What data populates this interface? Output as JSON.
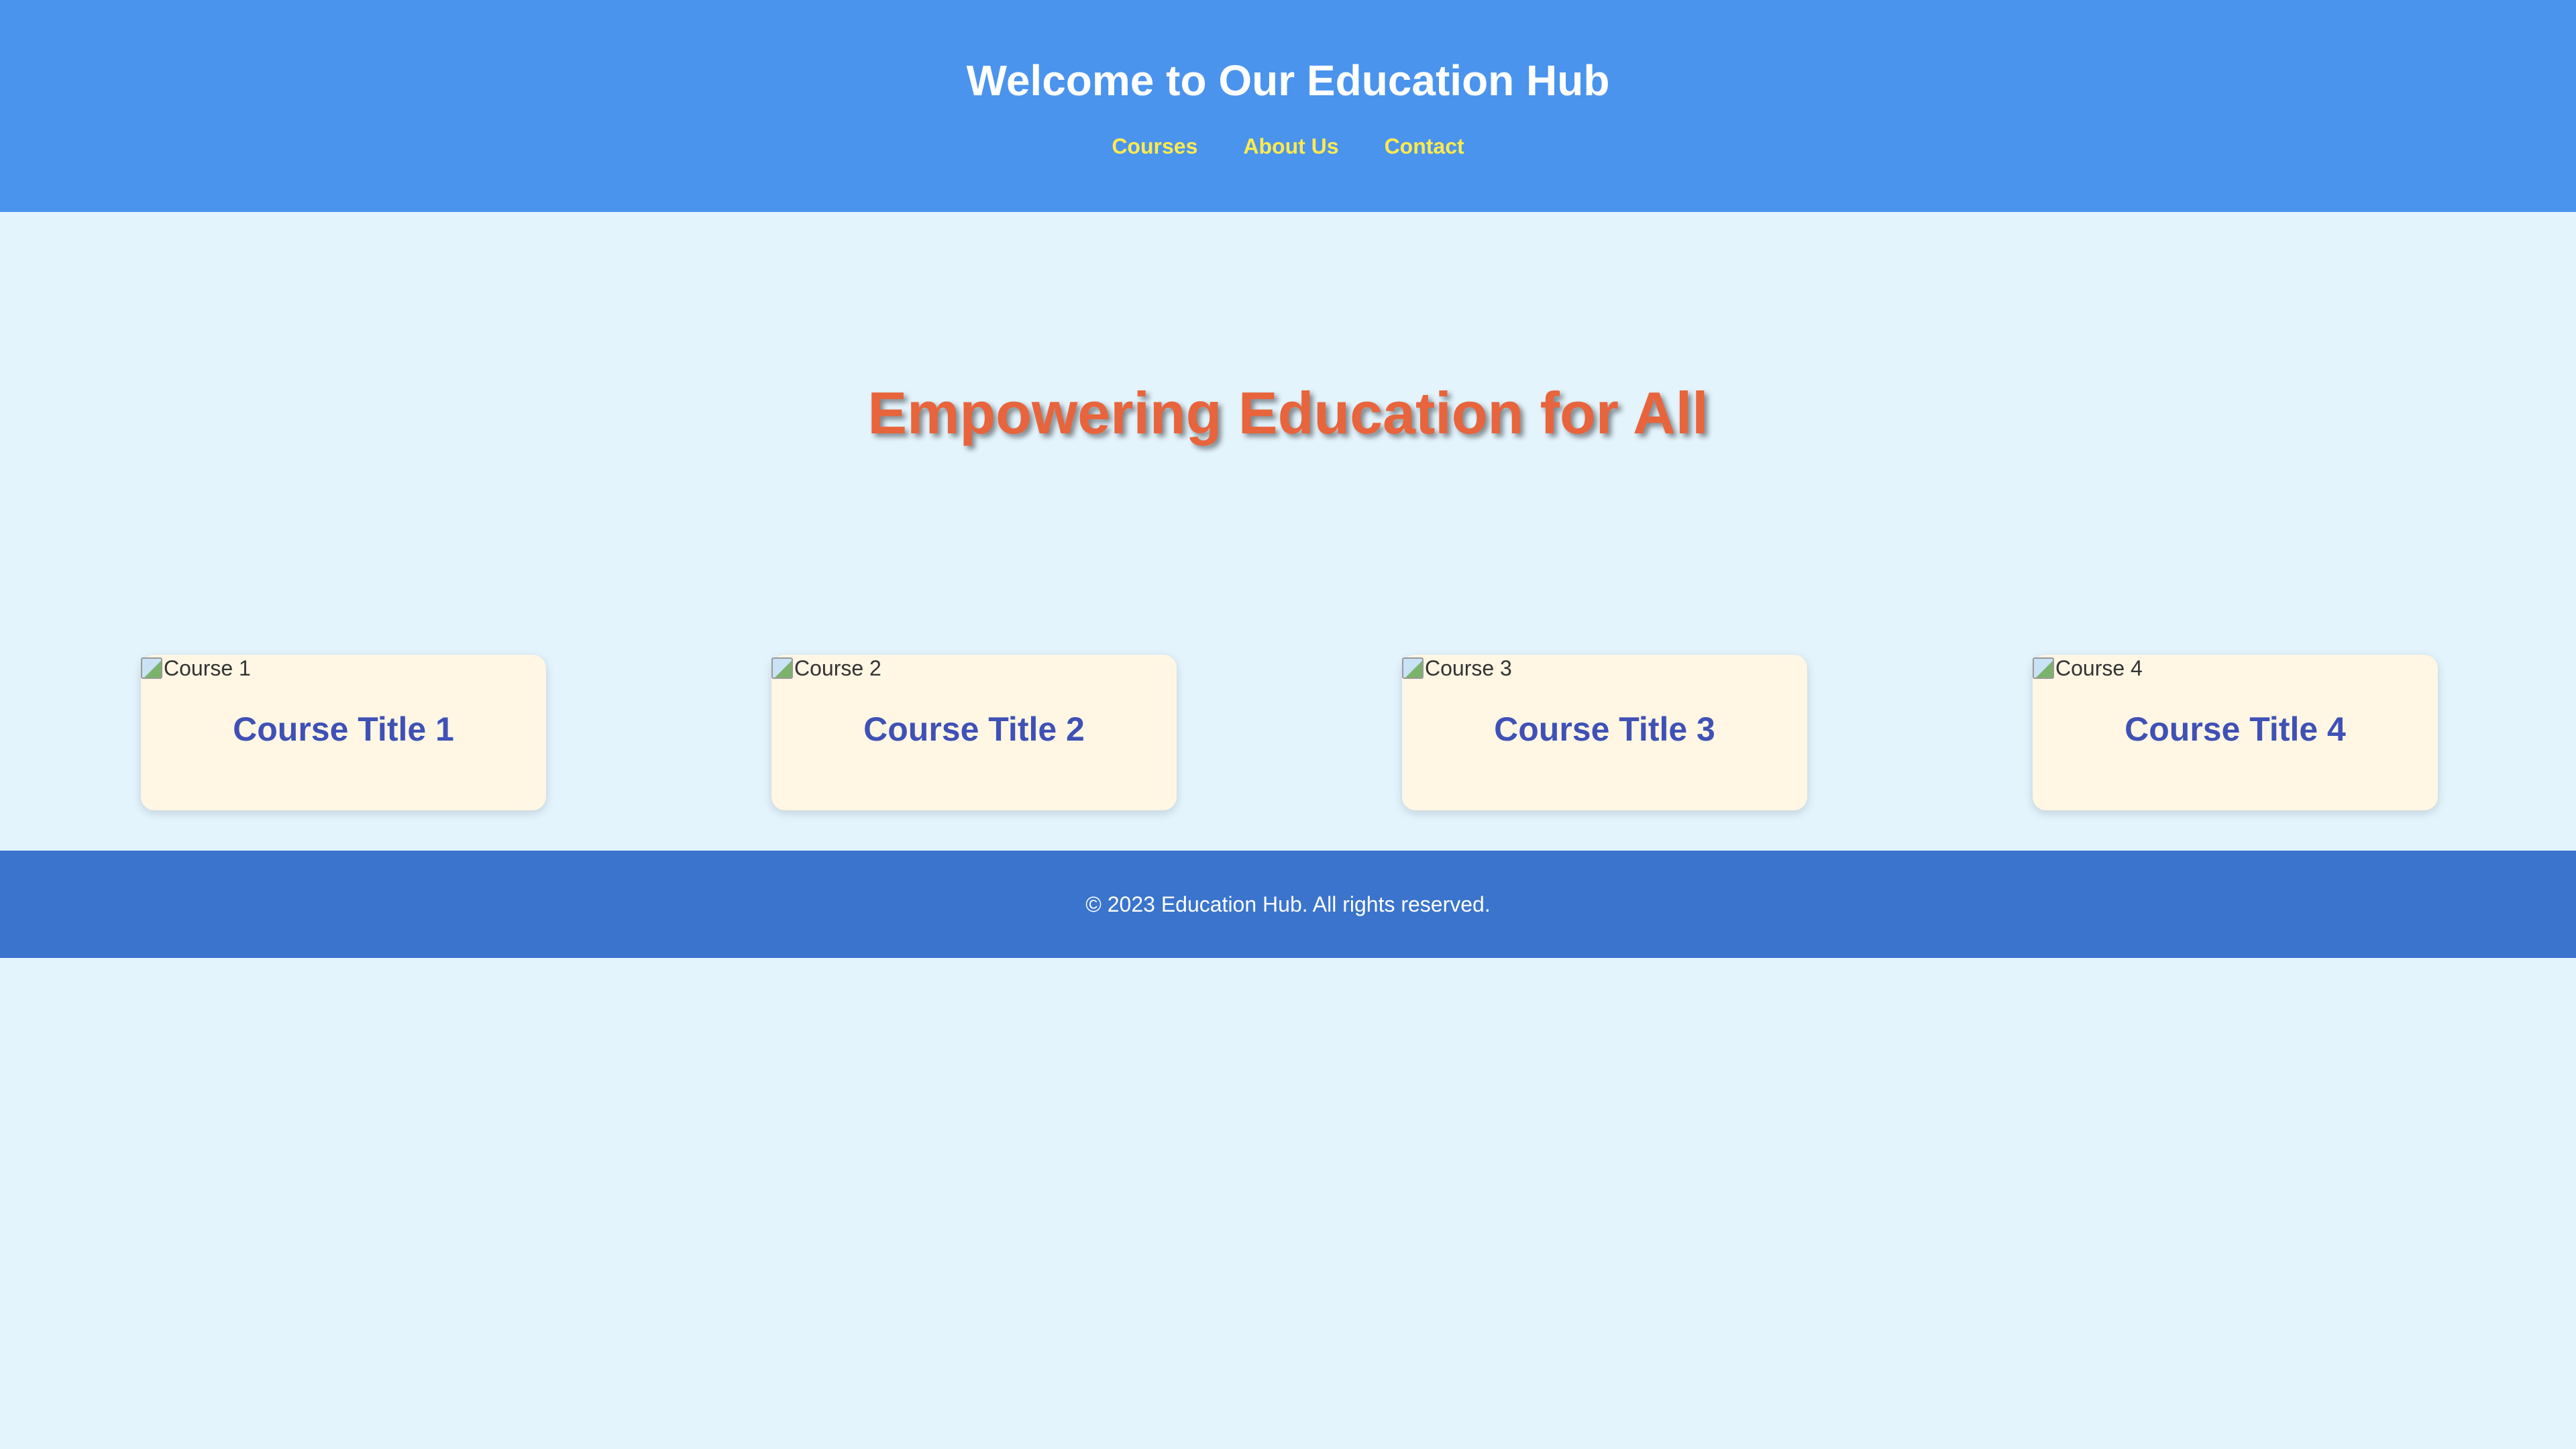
{
  "header": {
    "title": "Welcome to Our Education Hub",
    "nav": [
      {
        "label": "Courses"
      },
      {
        "label": "About Us"
      },
      {
        "label": "Contact"
      }
    ]
  },
  "hero": {
    "title": "Empowering Education for All"
  },
  "courses": [
    {
      "image_alt": "Course 1",
      "title": "Course Title 1"
    },
    {
      "image_alt": "Course 2",
      "title": "Course Title 2"
    },
    {
      "image_alt": "Course 3",
      "title": "Course Title 3"
    },
    {
      "image_alt": "Course 4",
      "title": "Course Title 4"
    }
  ],
  "footer": {
    "text": "© 2023 Education Hub. All rights reserved."
  },
  "colors": {
    "header_bg": "#4a94ed",
    "nav_link": "#ffea4f",
    "hero_title": "#e8643c",
    "card_bg": "#fff6e4",
    "card_title": "#3f51b5",
    "footer_bg": "#3a74cc",
    "page_bg": "#e3f4fd"
  }
}
